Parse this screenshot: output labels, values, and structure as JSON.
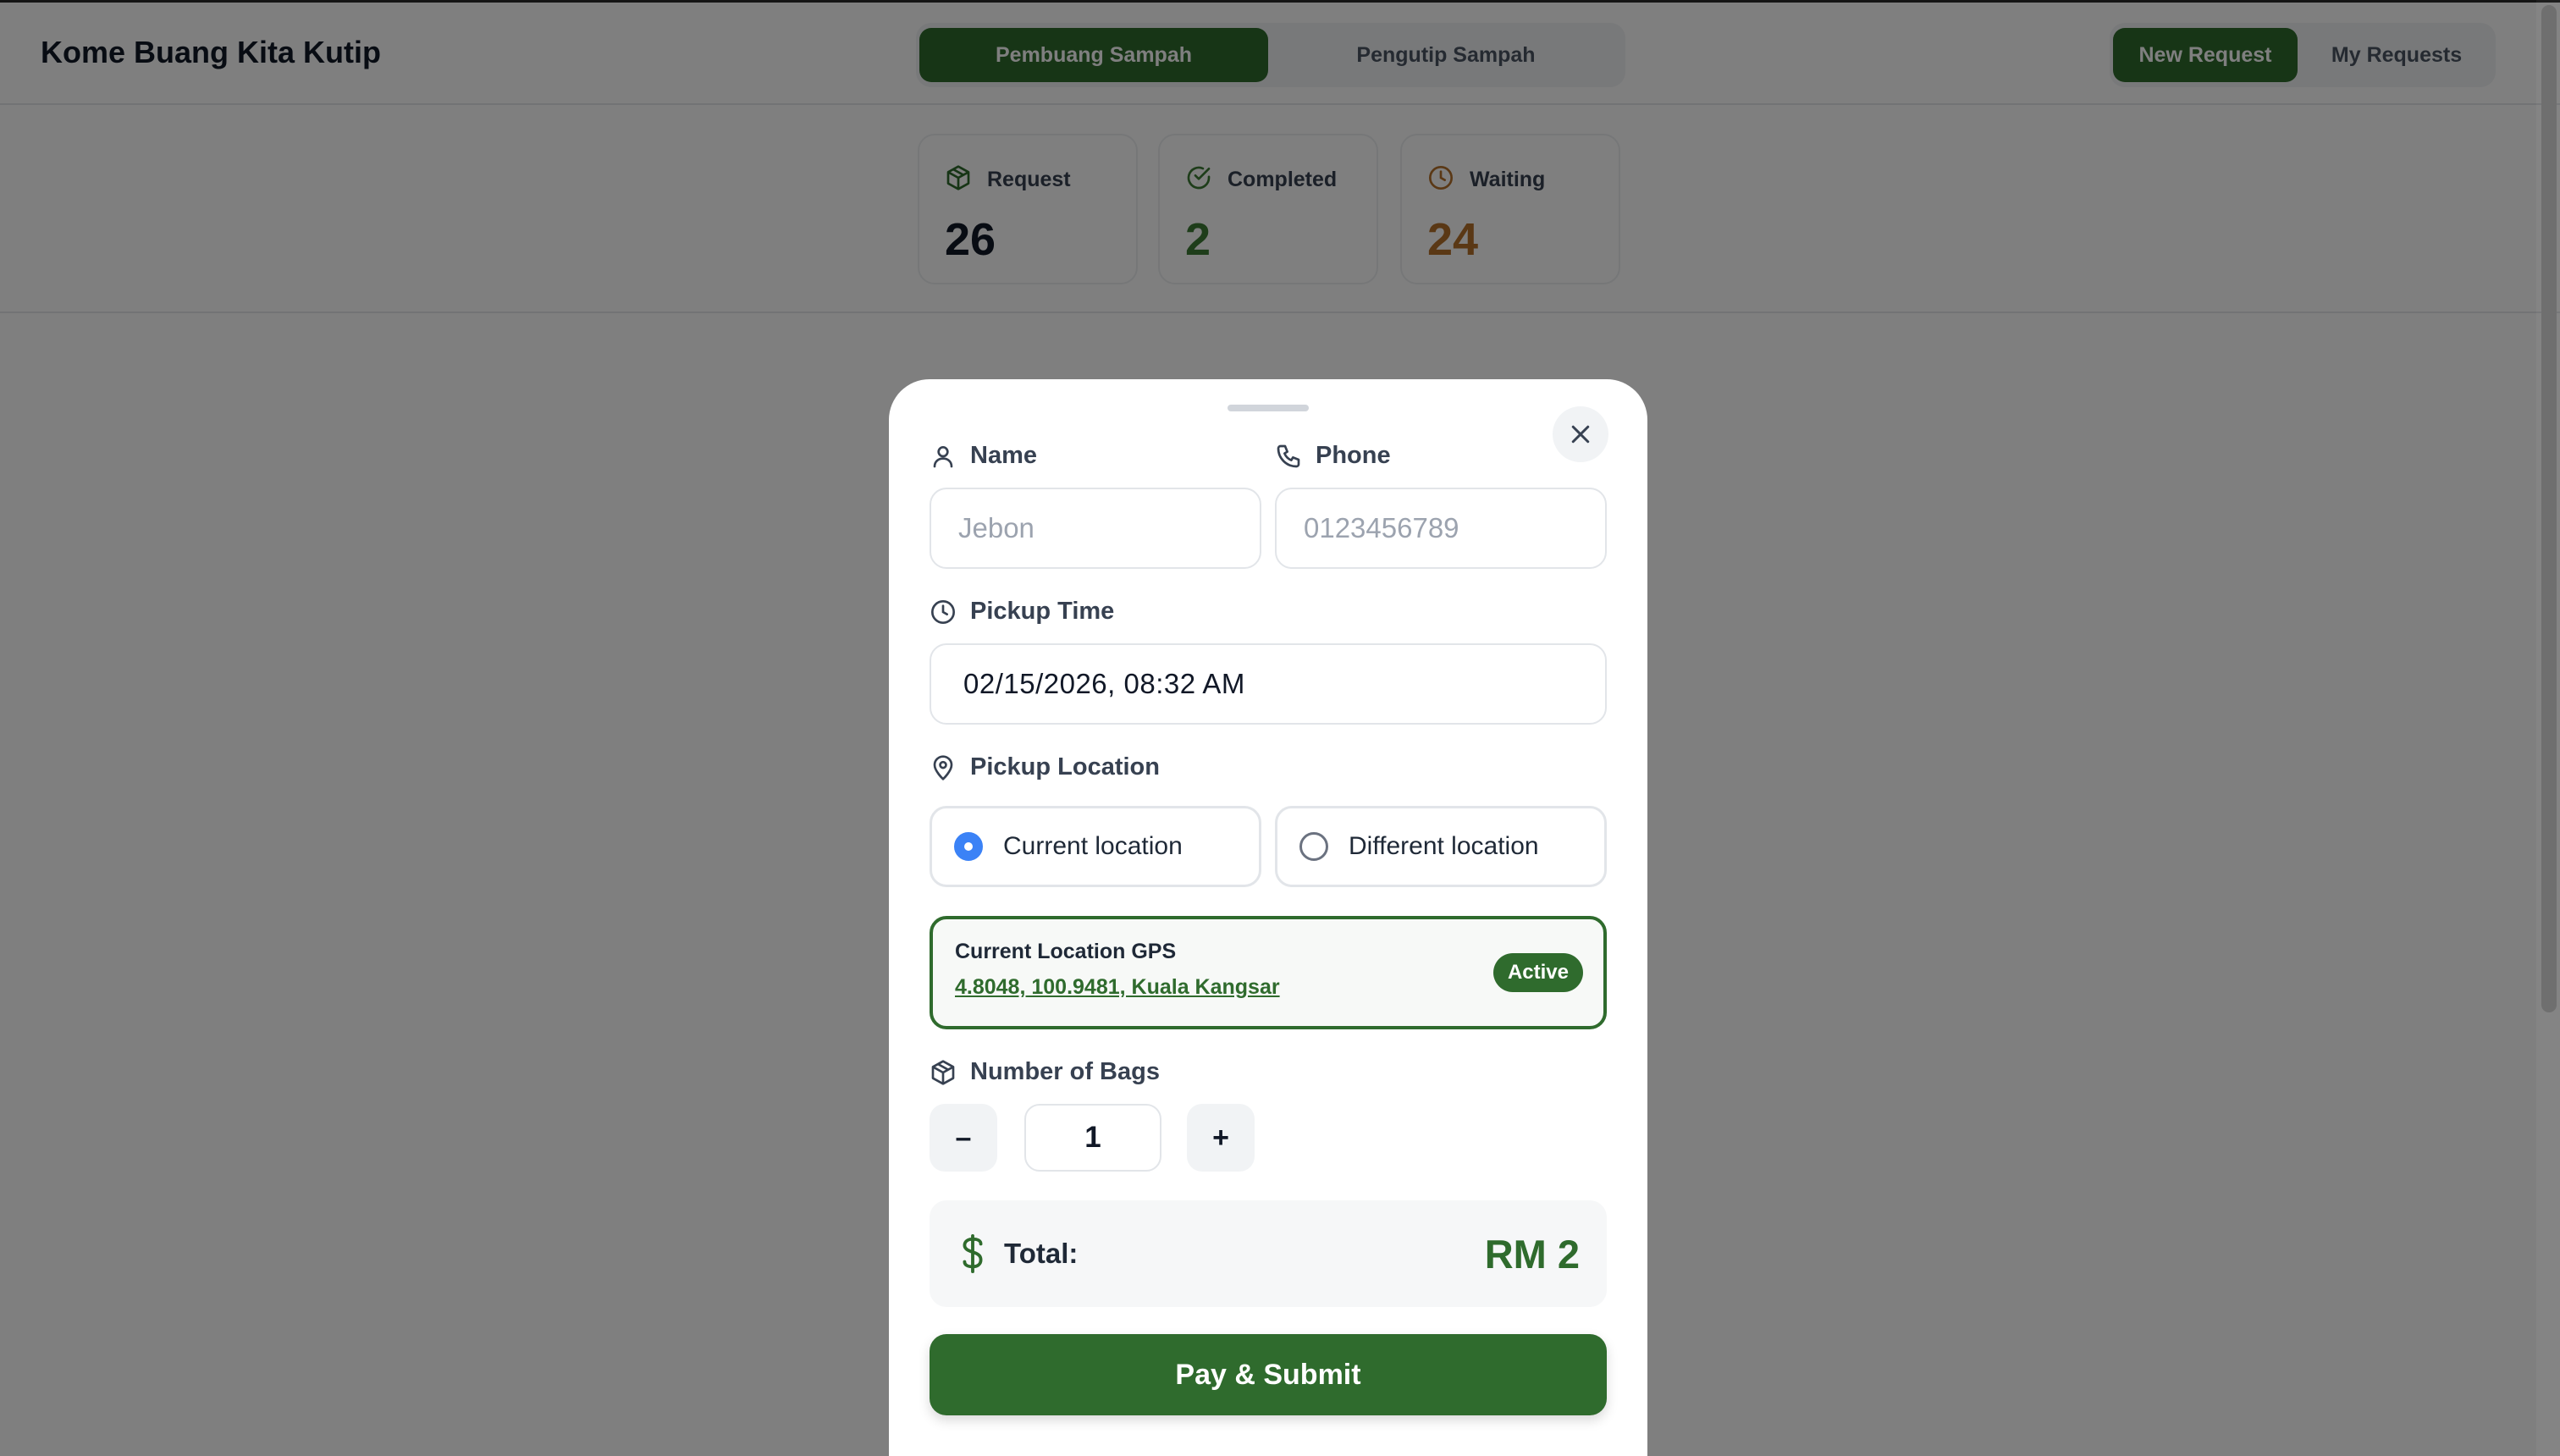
{
  "app": {
    "title": "Kome Buang Kita Kutip"
  },
  "roles": {
    "active": "Pembuang Sampah",
    "inactive": "Pengutip Sampah"
  },
  "views": {
    "active": "New Request",
    "inactive": "My Requests"
  },
  "stats": {
    "request": {
      "label": "Request",
      "value": "26",
      "color": "#111827"
    },
    "completed": {
      "label": "Completed",
      "value": "2",
      "color": "#3c7a35"
    },
    "waiting": {
      "label": "Waiting",
      "value": "24",
      "color": "#b5702a"
    }
  },
  "form": {
    "name": {
      "label": "Name",
      "placeholder": "Jebon"
    },
    "phone": {
      "label": "Phone",
      "placeholder": "0123456789"
    },
    "pickup_time": {
      "label": "Pickup Time",
      "value": "02/15/2026, 08:32 AM"
    },
    "pickup_location": {
      "label": "Pickup Location",
      "options": [
        "Current location",
        "Different location"
      ],
      "selected": "Current location"
    },
    "gps": {
      "title": "Current Location GPS",
      "coords": "4.8048, 100.9481, Kuala Kangsar",
      "badge": "Active"
    },
    "bags": {
      "label": "Number of Bags",
      "value": "1",
      "minus": "–",
      "plus": "+"
    },
    "total": {
      "label": "Total:",
      "value": "RM 2"
    },
    "submit": "Pay & Submit"
  },
  "colors": {
    "primary": "#2f6b2d",
    "radio_selected": "#3b82f6"
  }
}
